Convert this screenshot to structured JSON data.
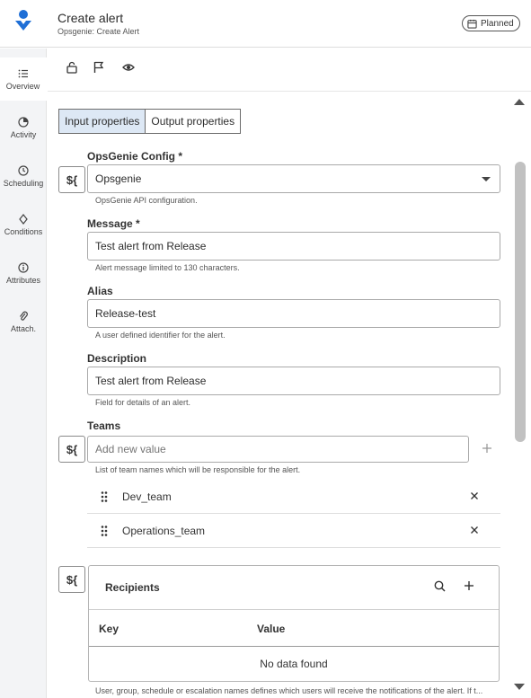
{
  "header": {
    "title": "Create alert",
    "subtitle": "Opsgenie: Create Alert",
    "status_badge": "Planned"
  },
  "sidebar": {
    "items": [
      {
        "label": "Overview",
        "icon": "list-icon",
        "active": true
      },
      {
        "label": "Activity",
        "icon": "pie-icon",
        "active": false
      },
      {
        "label": "Scheduling",
        "icon": "clock-icon",
        "active": false
      },
      {
        "label": "Conditions",
        "icon": "diamond-icon",
        "active": false
      },
      {
        "label": "Attributes",
        "icon": "info-icon",
        "active": false
      },
      {
        "label": "Attach.",
        "icon": "paperclip-icon",
        "active": false
      }
    ]
  },
  "toolbar": {
    "icons": [
      "lock-open-icon",
      "flag-icon",
      "eye-icon"
    ]
  },
  "tabs": [
    {
      "label": "Input properties",
      "active": true
    },
    {
      "label": "Output properties",
      "active": false
    }
  ],
  "form": {
    "dollar_label": "${",
    "config": {
      "label": "OpsGenie Config *",
      "value": "Opsgenie",
      "helper": "OpsGenie API configuration."
    },
    "message": {
      "label": "Message *",
      "value": "Test alert from Release",
      "helper": "Alert message limited to 130 characters."
    },
    "alias": {
      "label": "Alias",
      "value": "Release-test",
      "helper": "A user defined identifier for the alert."
    },
    "description": {
      "label": "Description",
      "value": "Test alert from Release",
      "helper": "Field for details of an alert."
    },
    "teams": {
      "label": "Teams",
      "placeholder": "Add new value",
      "helper": "List of team names which will be responsible for the alert.",
      "items": [
        "Dev_team",
        "Operations_team"
      ]
    },
    "recipients": {
      "title": "Recipients",
      "columns": [
        "Key",
        "Value"
      ],
      "empty": "No data found",
      "helper": "User, group, schedule or escalation names defines which users will receive the notifications of the alert. If t..."
    }
  },
  "colors": {
    "brand": "#1f6fd6",
    "active_tab": "#dde8f5",
    "sidebar_bg": "#f3f4f6"
  }
}
